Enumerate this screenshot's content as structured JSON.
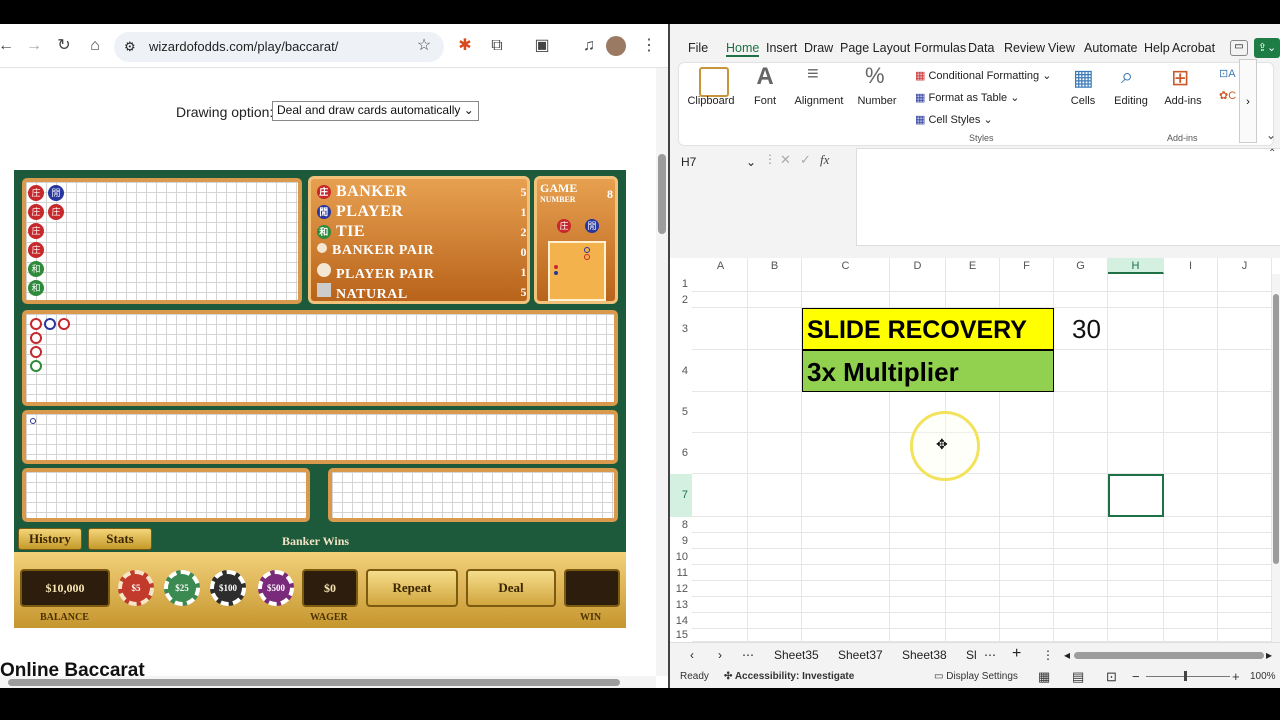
{
  "browser": {
    "url": "wizardofodds.com/play/baccarat/",
    "drawing_label": "Drawing option:",
    "drawing_value": "Deal and draw cards automatically",
    "heading": "Online Baccarat"
  },
  "bigroad": {
    "rows": [
      [
        "庄",
        "閒"
      ],
      [
        "庄",
        "庄"
      ],
      [
        "庄"
      ],
      [
        "庄"
      ],
      [
        "和"
      ],
      [
        "和"
      ]
    ]
  },
  "stats": {
    "banker_label": "BANKER",
    "banker": "5",
    "player_label": "PLAYER",
    "player": "1",
    "tie_label": "TIE",
    "tie": "2",
    "bpair_label": "BANKER PAIR",
    "bpair": "0",
    "ppair_label": "PLAYER PAIR",
    "ppair": "1",
    "natural_label": "NATURAL",
    "natural": "5",
    "icons": {
      "banker": "庄",
      "player": "閒",
      "tie": "和"
    }
  },
  "gamenum": {
    "line1": "GAME",
    "line2": "NUMBER",
    "value": "8",
    "banker_icon": "庄",
    "player_icon": "閒"
  },
  "buttons": {
    "history": "History",
    "stats": "Stats",
    "repeat": "Repeat",
    "deal": "Deal"
  },
  "result": "Banker Wins",
  "bar": {
    "balance": "$10,000",
    "balance_label": "BALANCE",
    "wager": "$0",
    "wager_label": "WAGER",
    "win_label": "WIN",
    "chips": [
      "$5",
      "$25",
      "$100",
      "$500"
    ]
  },
  "excel": {
    "menus": [
      "File",
      "Home",
      "Insert",
      "Draw",
      "Page Layout",
      "Formulas",
      "Data",
      "Review",
      "View",
      "Automate",
      "Help",
      "Acrobat"
    ],
    "ribbon": {
      "clipboard": "Clipboard",
      "font": "Font",
      "alignment": "Alignment",
      "number": "Number",
      "cond_format": "Conditional Formatting",
      "format_table": "Format as Table",
      "cell_styles": "Cell Styles",
      "styles": "Styles",
      "cells": "Cells",
      "editing": "Editing",
      "addins": "Add-ins",
      "addins_group": "Add-ins"
    },
    "namebox": "H7",
    "fx": "fx",
    "columns": [
      "A",
      "B",
      "C",
      "D",
      "E",
      "F",
      "G",
      "H",
      "I",
      "J"
    ],
    "rows": [
      "1",
      "2",
      "3",
      "4",
      "5",
      "6",
      "7",
      "8",
      "9",
      "10",
      "11",
      "12",
      "13",
      "14",
      "15"
    ],
    "cells": {
      "slide": "SLIDE RECOVERY",
      "mult": "3x Multiplier",
      "g3": "30"
    },
    "tabs": [
      "Sheet35",
      "Sheet37",
      "Sheet38",
      "Sl"
    ],
    "status": {
      "ready": "Ready",
      "access": "Accessibility: Investigate",
      "display": "Display Settings",
      "zoom": "100%"
    },
    "colors": {
      "yellow": "#ffff00",
      "green": "#92d050"
    }
  }
}
